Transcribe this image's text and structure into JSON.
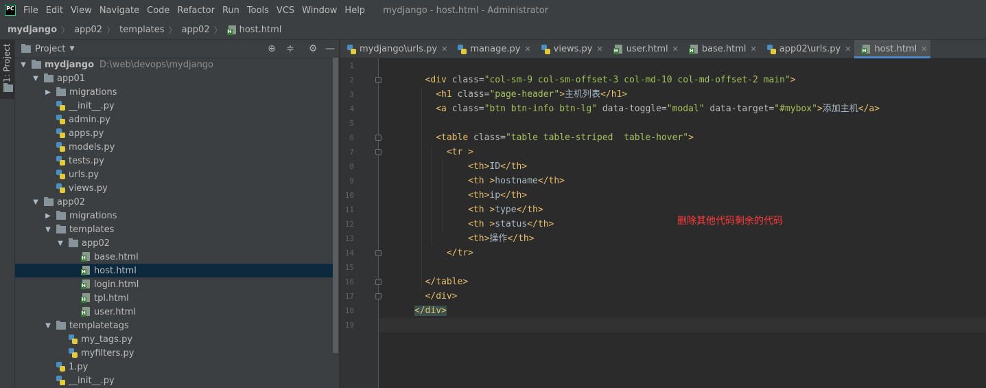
{
  "menubar": {
    "logo_text": "PC",
    "items": [
      "File",
      "Edit",
      "View",
      "Navigate",
      "Code",
      "Refactor",
      "Run",
      "Tools",
      "VCS",
      "Window",
      "Help"
    ],
    "window_title": "mydjango - host.html - Administrator"
  },
  "breadcrumb": [
    "mydjango",
    "app02",
    "templates",
    "app02",
    "host.html"
  ],
  "tool_strip": {
    "project_label": "1: Project"
  },
  "project_panel": {
    "title": "Project",
    "tree": [
      {
        "label": "mydjango",
        "path": "D:\\web\\devops\\mydjango",
        "depth": 0,
        "type": "folder",
        "expanded": true
      },
      {
        "label": "app01",
        "depth": 1,
        "type": "folder",
        "expanded": true
      },
      {
        "label": "migrations",
        "depth": 2,
        "type": "folder",
        "expanded": false
      },
      {
        "label": "__init__.py",
        "depth": 2,
        "type": "py"
      },
      {
        "label": "admin.py",
        "depth": 2,
        "type": "py"
      },
      {
        "label": "apps.py",
        "depth": 2,
        "type": "py"
      },
      {
        "label": "models.py",
        "depth": 2,
        "type": "py"
      },
      {
        "label": "tests.py",
        "depth": 2,
        "type": "py"
      },
      {
        "label": "urls.py",
        "depth": 2,
        "type": "py"
      },
      {
        "label": "views.py",
        "depth": 2,
        "type": "py"
      },
      {
        "label": "app02",
        "depth": 1,
        "type": "folder",
        "expanded": true
      },
      {
        "label": "migrations",
        "depth": 2,
        "type": "folder",
        "expanded": false
      },
      {
        "label": "templates",
        "depth": 2,
        "type": "folder",
        "expanded": true
      },
      {
        "label": "app02",
        "depth": 3,
        "type": "folder",
        "expanded": true
      },
      {
        "label": "base.html",
        "depth": 4,
        "type": "html"
      },
      {
        "label": "host.html",
        "depth": 4,
        "type": "html",
        "selected": true
      },
      {
        "label": "login.html",
        "depth": 4,
        "type": "html"
      },
      {
        "label": "tpl.html",
        "depth": 4,
        "type": "html"
      },
      {
        "label": "user.html",
        "depth": 4,
        "type": "html"
      },
      {
        "label": "templatetags",
        "depth": 2,
        "type": "folder",
        "expanded": true
      },
      {
        "label": "my_tags.py",
        "depth": 3,
        "type": "py"
      },
      {
        "label": "myfilters.py",
        "depth": 3,
        "type": "py"
      },
      {
        "label": "1.py",
        "depth": 2,
        "type": "py"
      },
      {
        "label": "__init__.py",
        "depth": 2,
        "type": "py"
      }
    ]
  },
  "editor_tabs": [
    {
      "label": "mydjango\\urls.py",
      "icon": "python-icon"
    },
    {
      "label": "manage.py",
      "icon": "python-icon"
    },
    {
      "label": "views.py",
      "icon": "python-icon"
    },
    {
      "label": "user.html",
      "icon": "html-icon"
    },
    {
      "label": "base.html",
      "icon": "html-icon"
    },
    {
      "label": "app02\\urls.py",
      "icon": "python-icon"
    },
    {
      "label": "host.html",
      "icon": "html-icon",
      "active": true
    }
  ],
  "editor": {
    "lines": [
      {
        "n": "1",
        "indent": 0,
        "tokens": []
      },
      {
        "n": "2",
        "indent": 8,
        "tokens": [
          [
            "tg",
            "<div "
          ],
          [
            "at",
            "class="
          ],
          [
            "sv",
            "\"col-sm-9 col-sm-offset-3 col-md-10 col-md-offset-2 main\""
          ],
          [
            "tg",
            ">"
          ]
        ]
      },
      {
        "n": "3",
        "indent": 10,
        "tokens": [
          [
            "tg",
            "<h1 "
          ],
          [
            "at",
            "class="
          ],
          [
            "sv",
            "\"page-header\""
          ],
          [
            "tg",
            ">"
          ],
          [
            "tx",
            "主机列表"
          ],
          [
            "tg",
            "</h1>"
          ]
        ]
      },
      {
        "n": "4",
        "indent": 10,
        "tokens": [
          [
            "tg",
            "<a "
          ],
          [
            "at",
            "class="
          ],
          [
            "sv",
            "\"btn btn-info btn-lg\" "
          ],
          [
            "at",
            "data-toggle="
          ],
          [
            "sv",
            "\"modal\" "
          ],
          [
            "at",
            "data-target="
          ],
          [
            "sv",
            "\"#mybox\""
          ],
          [
            "tg",
            ">"
          ],
          [
            "tx",
            "添加主机"
          ],
          [
            "tg",
            "</a>"
          ]
        ]
      },
      {
        "n": "5",
        "indent": 0,
        "tokens": []
      },
      {
        "n": "6",
        "indent": 10,
        "tokens": [
          [
            "tg",
            "<table "
          ],
          [
            "at",
            "class="
          ],
          [
            "sv",
            "\"table table-striped  table-hover\""
          ],
          [
            "tg",
            ">"
          ]
        ]
      },
      {
        "n": "7",
        "indent": 12,
        "tokens": [
          [
            "tg",
            "<tr >"
          ]
        ]
      },
      {
        "n": "8",
        "indent": 16,
        "tokens": [
          [
            "tg",
            "<th>"
          ],
          [
            "tx",
            "ID"
          ],
          [
            "tg",
            "</th>"
          ]
        ]
      },
      {
        "n": "9",
        "indent": 16,
        "tokens": [
          [
            "tg",
            "<th >"
          ],
          [
            "tx",
            "hostname"
          ],
          [
            "tg",
            "</th>"
          ]
        ]
      },
      {
        "n": "10",
        "indent": 16,
        "tokens": [
          [
            "tg",
            "<th>"
          ],
          [
            "tx",
            "ip"
          ],
          [
            "tg",
            "</th>"
          ]
        ]
      },
      {
        "n": "11",
        "indent": 16,
        "tokens": [
          [
            "tg",
            "<th >"
          ],
          [
            "tx",
            "type"
          ],
          [
            "tg",
            "</th>"
          ]
        ]
      },
      {
        "n": "12",
        "indent": 16,
        "tokens": [
          [
            "tg",
            "<th >"
          ],
          [
            "tx",
            "status"
          ],
          [
            "tg",
            "</th>"
          ]
        ]
      },
      {
        "n": "13",
        "indent": 16,
        "tokens": [
          [
            "tg",
            "<th>"
          ],
          [
            "tx",
            "操作"
          ],
          [
            "tg",
            "</th>"
          ]
        ]
      },
      {
        "n": "14",
        "indent": 12,
        "tokens": [
          [
            "tg",
            "</tr>"
          ]
        ]
      },
      {
        "n": "15",
        "indent": 0,
        "tokens": []
      },
      {
        "n": "16",
        "indent": 8,
        "tokens": [
          [
            "tg",
            "</table>"
          ]
        ]
      },
      {
        "n": "17",
        "indent": 8,
        "tokens": [
          [
            "tg",
            "</div>"
          ]
        ]
      },
      {
        "n": "18",
        "indent": 6,
        "tokens": [
          [
            "tg hl",
            "</div>"
          ]
        ]
      },
      {
        "n": "19",
        "indent": 0,
        "tokens": [],
        "current": true
      }
    ],
    "fold_lines": [
      "2",
      "6",
      "7",
      "14",
      "16",
      "17"
    ],
    "annotation": "删除其他代码剩余的代码",
    "annotation_color": "#ff3b3b"
  }
}
